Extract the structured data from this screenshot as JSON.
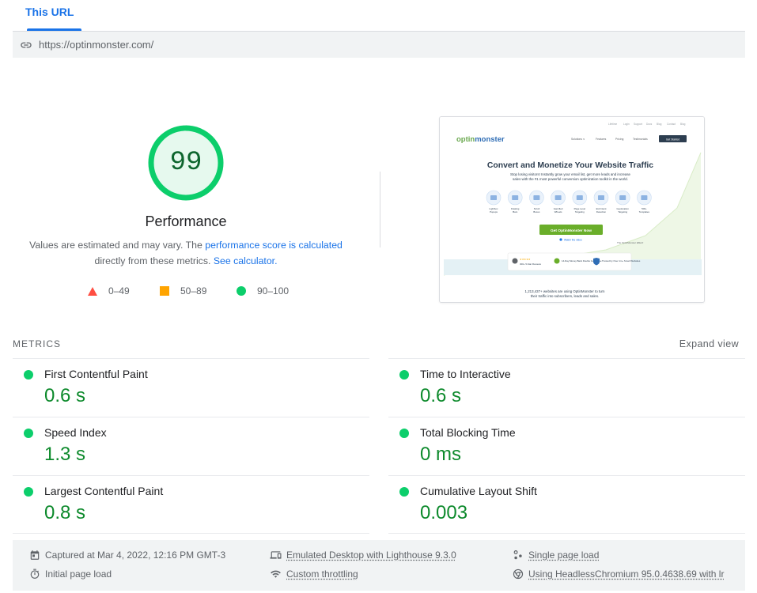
{
  "tabs": {
    "active_label": "This URL"
  },
  "url": {
    "value": "https://optinmonster.com/"
  },
  "score": {
    "value": "99",
    "fraction": 0.99,
    "title": "Performance",
    "desc_prefix": "Values are estimated and may vary. The ",
    "desc_link1": "performance score is calculated",
    "desc_middle": "directly from these metrics. ",
    "desc_link2": "See calculator.",
    "color": "#0cce6b",
    "text_color": "#0d652d"
  },
  "legend": [
    {
      "icon": "triangle-icon",
      "label": "0–49",
      "color": "#ff4e42"
    },
    {
      "icon": "square-icon",
      "label": "50–89",
      "color": "#ffa400"
    },
    {
      "icon": "circle-icon",
      "label": "90–100",
      "color": "#0cce6b"
    }
  ],
  "thumbnail": {
    "topnav": [
      "Lifetime",
      "Login",
      "Support",
      "Docs",
      "Blog",
      "Contact",
      "Blog"
    ],
    "logo_a": "optin",
    "logo_b": "monster",
    "nav": [
      "Solutions ∨",
      "Features",
      "Pricing",
      "Testimonials"
    ],
    "nav_cta": "Get Started",
    "headline": "Convert and Monetize Your Website Traffic",
    "sub1": "Stop losing visitors! Instantly grow your email list, get more leads and increase",
    "sub2": "sales with the #1 most powerful conversion optimization toolkit in the world.",
    "features": [
      "Lightbox Popups",
      "Floating Bars",
      "Scroll Boxes",
      "Gamified Wheels",
      "Page Level Targeting",
      "Exit Intent Detection",
      "Geolocation Targeting",
      "500+ Templates"
    ],
    "cta": "Get OptinMonster Now",
    "cta_note": "Watch the video",
    "effect_note": "The OptinMonster Effect!",
    "badges": [
      "300+ 5-Star Reviews",
      "14-Day Money Back Double Guarantee",
      "Trusted by Over 1m+ Smart Websites"
    ],
    "bottom1": "1,213,437+ websites are using OptinMonster to turn",
    "bottom2": "their traffic into subscribers, leads and sales."
  },
  "metrics": {
    "heading": "METRICS",
    "expand_label": "Expand view",
    "left": [
      {
        "name": "First Contentful Paint",
        "value": "0.6 s"
      },
      {
        "name": "Speed Index",
        "value": "1.3 s"
      },
      {
        "name": "Largest Contentful Paint",
        "value": "0.8 s"
      }
    ],
    "right": [
      {
        "name": "Time to Interactive",
        "value": "0.6 s"
      },
      {
        "name": "Total Blocking Time",
        "value": "0 ms"
      },
      {
        "name": "Cumulative Layout Shift",
        "value": "0.003"
      }
    ],
    "good_color": "#0cce6b",
    "value_color": "#0d8a2c"
  },
  "footer": {
    "captured": "Captured at Mar 4, 2022, 12:16 PM GMT-3",
    "initial_load": "Initial page load",
    "emulated": "Emulated Desktop with Lighthouse 9.3.0",
    "throttling": "Custom throttling",
    "single_load": "Single page load",
    "browser": "Using HeadlessChromium 95.0.4638.69 with lr"
  }
}
